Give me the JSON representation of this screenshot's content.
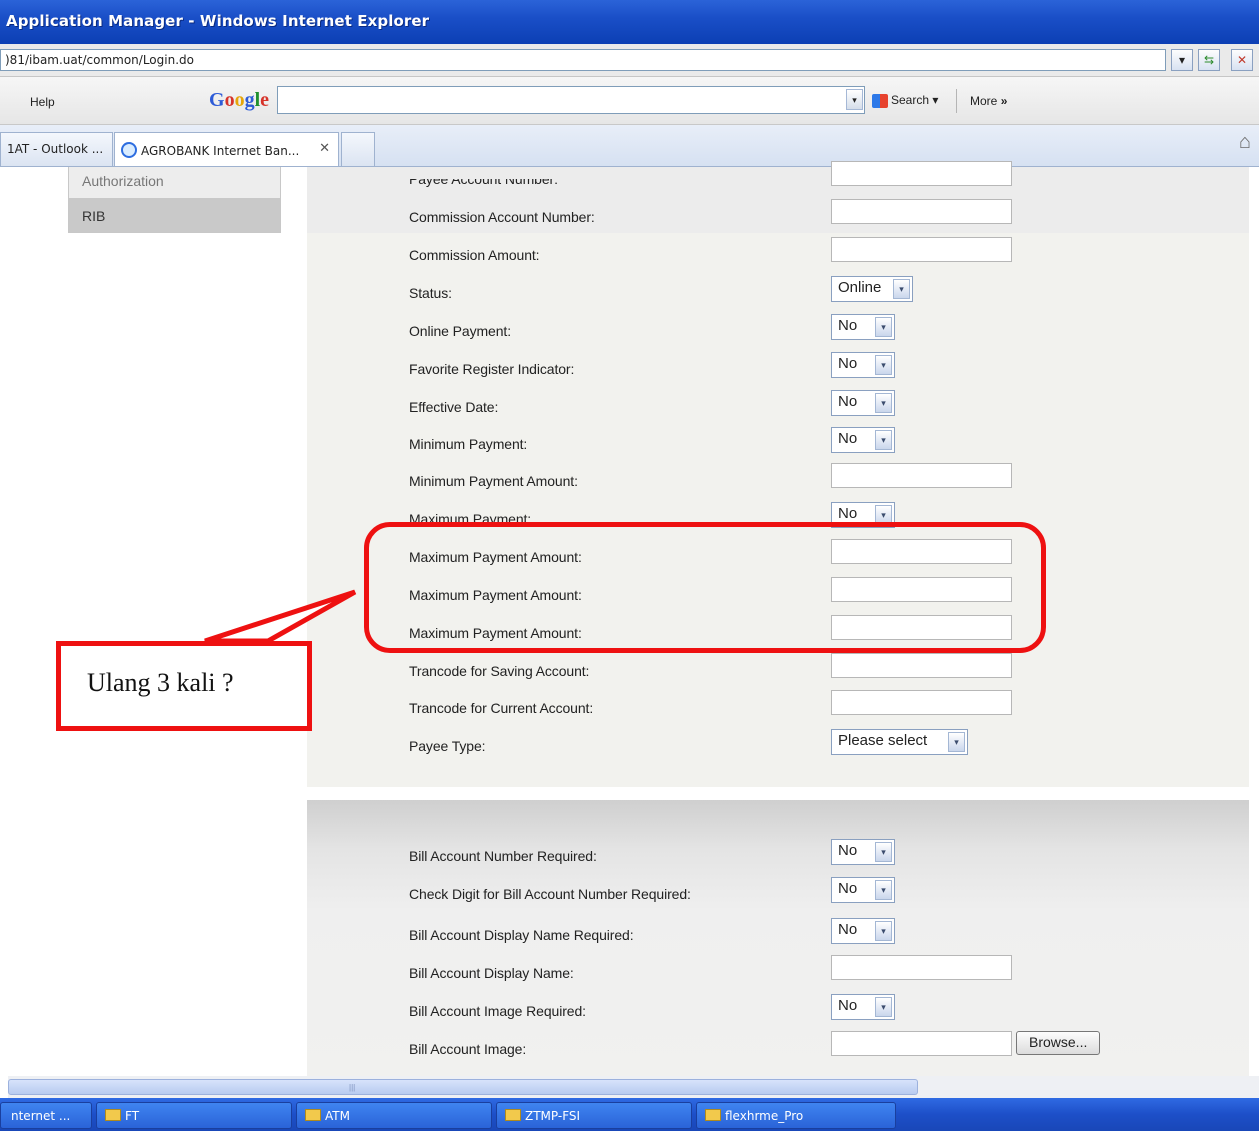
{
  "window": {
    "title": "Application Manager - Windows Internet Explorer"
  },
  "address": {
    "url": ")81/ibam.uat/common/Login.do"
  },
  "toolbar": {
    "help_label": "Help",
    "search_label": "Search",
    "more_label": "More"
  },
  "tabs": [
    {
      "label": "1AT - Outlook ..."
    },
    {
      "label": "AGROBANK Internet Ban..."
    }
  ],
  "sidebar": {
    "items": [
      {
        "label": "Authorization"
      },
      {
        "label": "RIB"
      }
    ]
  },
  "form": {
    "fields": [
      {
        "label": "Payee Account Number:",
        "type": "text",
        "value": ""
      },
      {
        "label": "Commission Account Number:",
        "type": "text",
        "value": ""
      },
      {
        "label": "Commission Amount:",
        "type": "text",
        "value": ""
      },
      {
        "label": "Status:",
        "type": "select",
        "value": "Online"
      },
      {
        "label": "Online Payment:",
        "type": "select",
        "value": "No"
      },
      {
        "label": "Favorite Register Indicator:",
        "type": "select",
        "value": "No"
      },
      {
        "label": "Effective Date:",
        "type": "select",
        "value": "No"
      },
      {
        "label": "Minimum Payment:",
        "type": "select",
        "value": "No"
      },
      {
        "label": "Minimum Payment Amount:",
        "type": "text",
        "value": ""
      },
      {
        "label": "Maximum Payment:",
        "type": "select",
        "value": "No"
      },
      {
        "label": "Maximum Payment Amount:",
        "type": "text",
        "value": ""
      },
      {
        "label": "Maximum Payment Amount:",
        "type": "text",
        "value": ""
      },
      {
        "label": "Maximum Payment Amount:",
        "type": "text",
        "value": ""
      },
      {
        "label": "Trancode for Saving Account:",
        "type": "text",
        "value": ""
      },
      {
        "label": "Trancode for Current Account:",
        "type": "text",
        "value": ""
      },
      {
        "label": "Payee Type:",
        "type": "select",
        "value": "Please select"
      }
    ],
    "bill_fields": [
      {
        "label": "Bill Account Number Required:",
        "type": "select",
        "value": "No"
      },
      {
        "label": "Check Digit for Bill Account Number Required:",
        "type": "select",
        "value": "No"
      },
      {
        "label": "Bill Account Display Name Required:",
        "type": "select",
        "value": "No"
      },
      {
        "label": "Bill Account Display Name:",
        "type": "text",
        "value": ""
      },
      {
        "label": "Bill Account Image Required:",
        "type": "select",
        "value": "No"
      },
      {
        "label": "Bill Account Image:",
        "type": "file",
        "value": ""
      }
    ],
    "browse_label": "Browse..."
  },
  "annotation": {
    "callout_text": "Ulang 3 kali ?",
    "color": "#ee1111"
  },
  "taskbar": {
    "items": [
      {
        "label": "nternet ..."
      },
      {
        "label": "FT"
      },
      {
        "label": "ATM"
      },
      {
        "label": "ZTMP-FSI"
      },
      {
        "label": "flexhrme_Pro"
      }
    ]
  },
  "colors": {
    "title_bar": "#1a4fc7",
    "panel": "#f2f2ee",
    "nav_selected": "#c9c9c9"
  }
}
